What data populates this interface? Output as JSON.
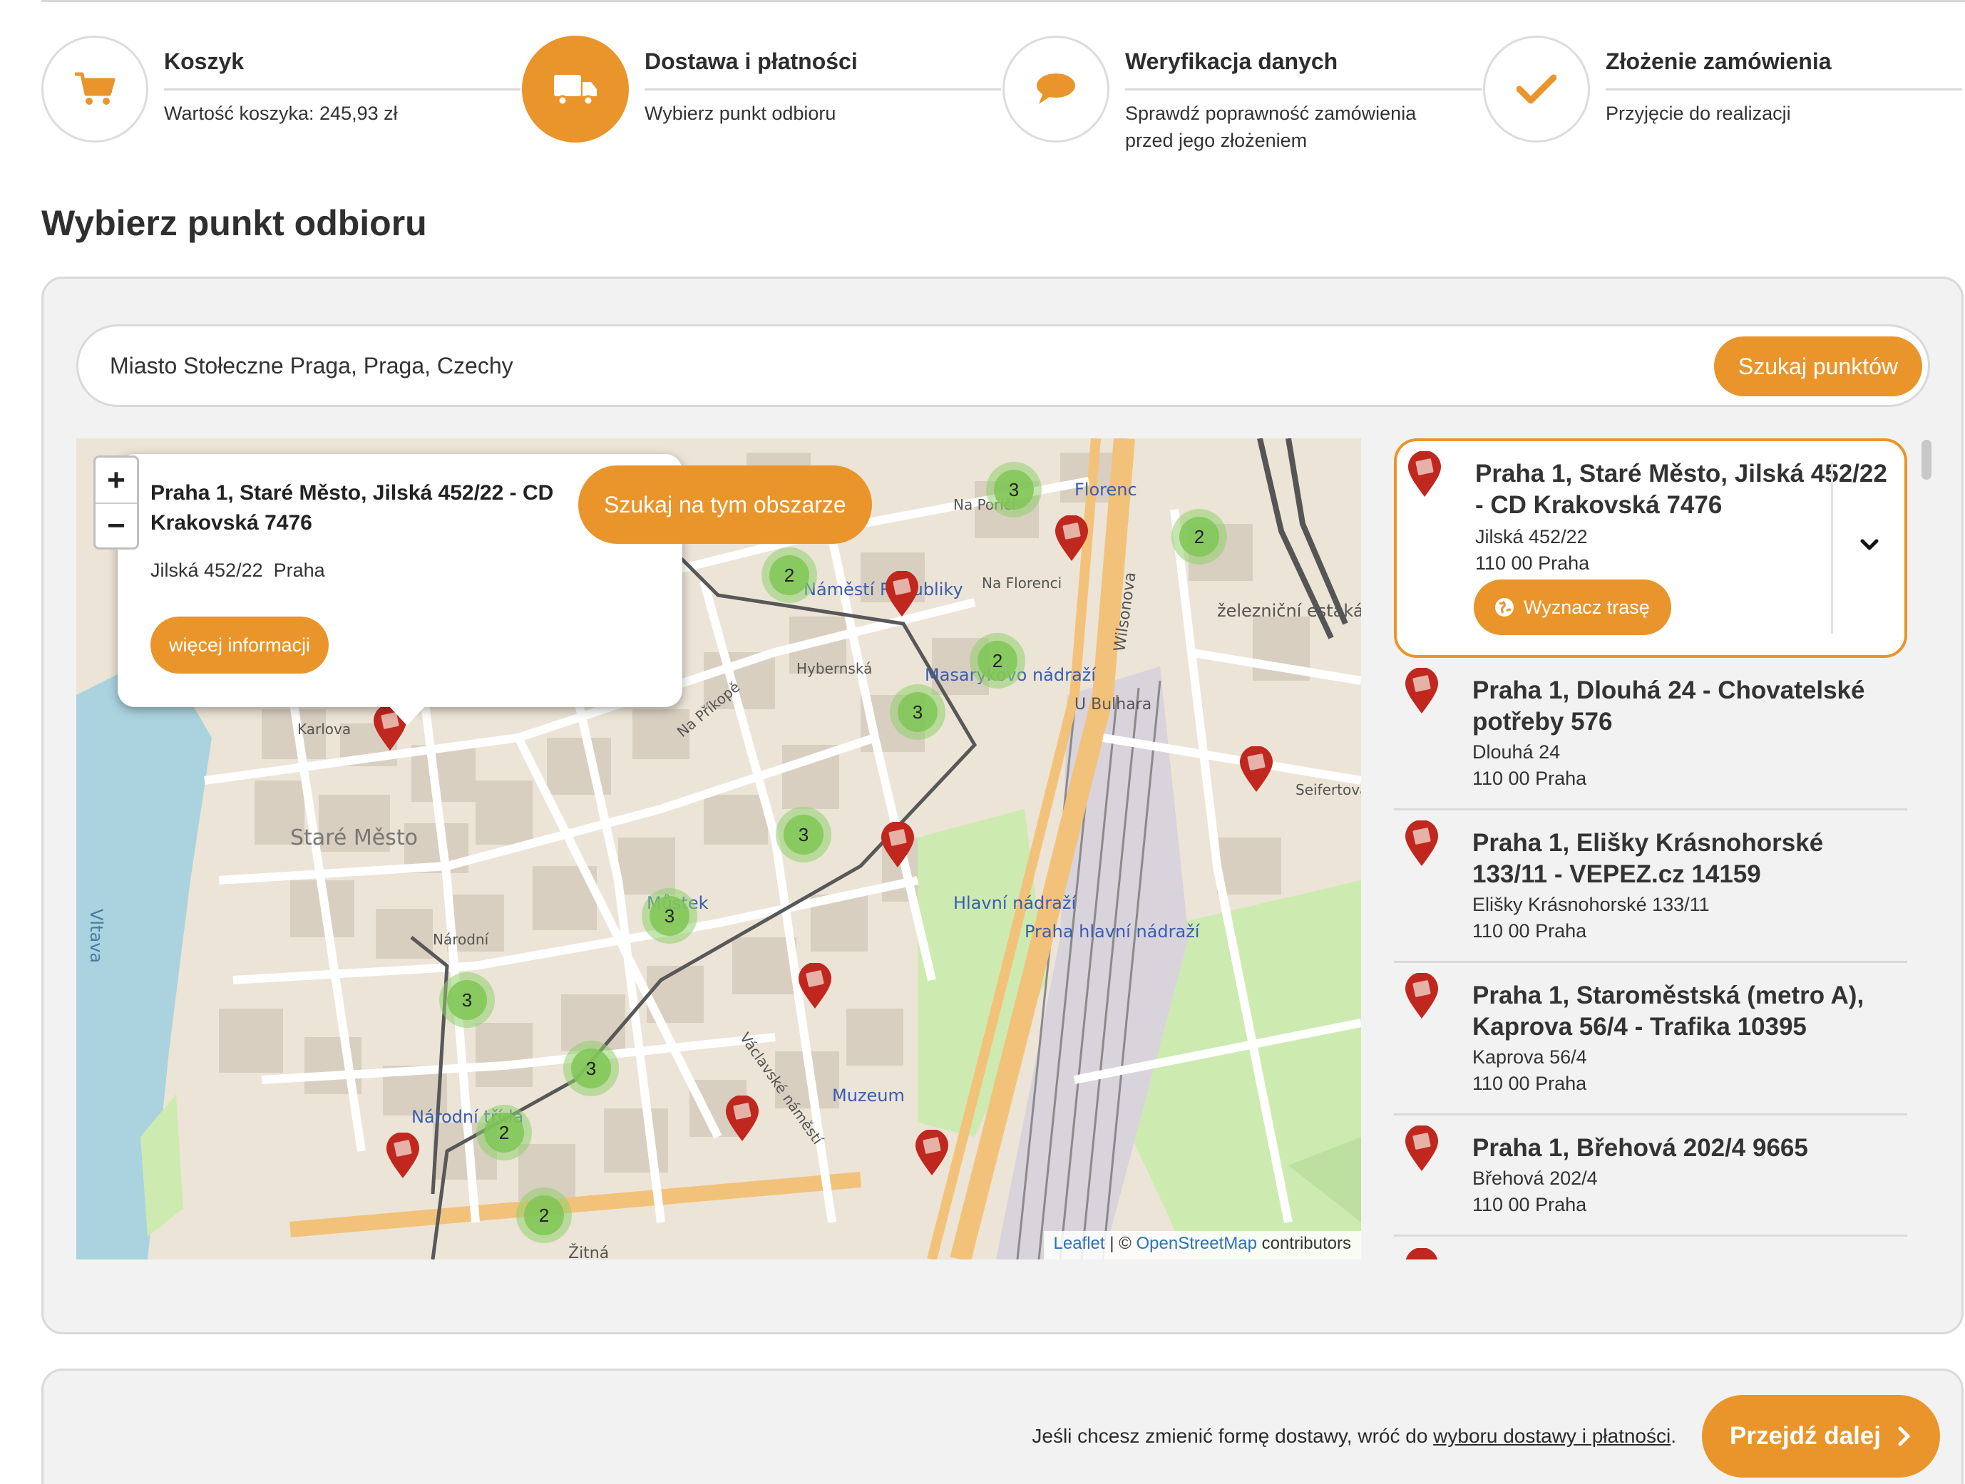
{
  "steps": [
    {
      "title": "Koszyk",
      "desc": "Wartość koszyka: 245,93 zł",
      "icon": "cart-icon",
      "active": false
    },
    {
      "title": "Dostawa i płatności",
      "desc": "Wybierz punkt odbioru",
      "icon": "truck-icon",
      "active": true
    },
    {
      "title": "Weryfikacja danych",
      "desc": "Sprawdź poprawność zamówienia przed jego złożeniem",
      "icon": "speech-bubble-icon",
      "active": false
    },
    {
      "title": "Złożenie zamówienia",
      "desc": "Przyjęcie do realizacji",
      "icon": "checkmark-icon",
      "active": false
    }
  ],
  "page_title": "Wybierz punkt odbioru",
  "search": {
    "value": "Miasto Stołeczne Praga, Praga, Czechy",
    "button": "Szukaj punktów"
  },
  "map": {
    "search_area_button": "Szukaj na tym obszarze",
    "zoom_in": "+",
    "zoom_out": "−",
    "popup": {
      "title": "Praha 1, Staré Město, Jilská 452/22 - CD Krakovská 7476",
      "street": "Jilská 452/22",
      "city": "Praha",
      "button": "więcej informacji"
    },
    "attribution": {
      "leaflet": "Leaflet",
      "separator": " | © ",
      "osm": "OpenStreetMap",
      "suffix": " contributors"
    },
    "labels": {
      "old_town": "Staré Město",
      "river": "Vltava",
      "republic_square": "Náměstí Republiky",
      "masaryk_station": "Masarykovo nádraží",
      "main_station": "Hlavní nádraží",
      "prague_main_station": "Praha hlavní nádraží",
      "mustek": "Můstek",
      "museum": "Muzeum",
      "narodni_trida": "Národní třída",
      "wilsonova": "Wilsonova",
      "florenc": "Florenc",
      "estakada": "železniční estakáda přes Masarykovo nádraží",
      "na_porici": "Na Poříčí",
      "na_florenci": "Na Florenci",
      "hybernska": "Hybernská",
      "na_prikope": "Na Příkopě",
      "vaclavske": "Václavské náměstí",
      "narodni": "Národní",
      "zitna": "Žitná",
      "seifertova": "Seifertova",
      "u_bulhara": "U Bulhara",
      "karlova": "Karlova"
    },
    "clusters": [
      "2",
      "3",
      "2",
      "2",
      "3",
      "3",
      "3",
      "3",
      "3",
      "2",
      "2"
    ],
    "colors": {
      "accent": "#e9952b",
      "pin": "#c0281f",
      "cluster": "#7fc556"
    }
  },
  "points": [
    {
      "title": "Praha 1, Staré Město, Jilská 452/22 - CD Krakovská 7476",
      "street": "Jilská 452/22",
      "city": "110 00 Praha",
      "selected": true,
      "route_button": "Wyznacz trasę"
    },
    {
      "title": "Praha 1, Dlouhá 24 - Chovatelské potřeby 576",
      "street": "Dlouhá 24",
      "city": "110 00 Praha",
      "selected": false
    },
    {
      "title": "Praha 1, Elišky Krásnohorské 133/11 - VEPEZ.cz 14159",
      "street": "Elišky Krásnohorské 133/11",
      "city": "110 00 Praha",
      "selected": false
    },
    {
      "title": "Praha 1, Staroměstská (metro A), Kaprova 56/4 - Trafika 10395",
      "street": "Kaprova 56/4",
      "city": "110 00 Praha",
      "selected": false
    },
    {
      "title": "Praha 1, Břehová 202/4 9665",
      "street": "Břehová 202/4",
      "city": "110 00 Praha",
      "selected": false
    }
  ],
  "footer": {
    "text_before": "Jeśli chcesz zmienić formę dostawy, wróć do ",
    "link": "wyboru dostawy i płatności",
    "text_after": ".",
    "next_button": "Przejdź dalej"
  }
}
